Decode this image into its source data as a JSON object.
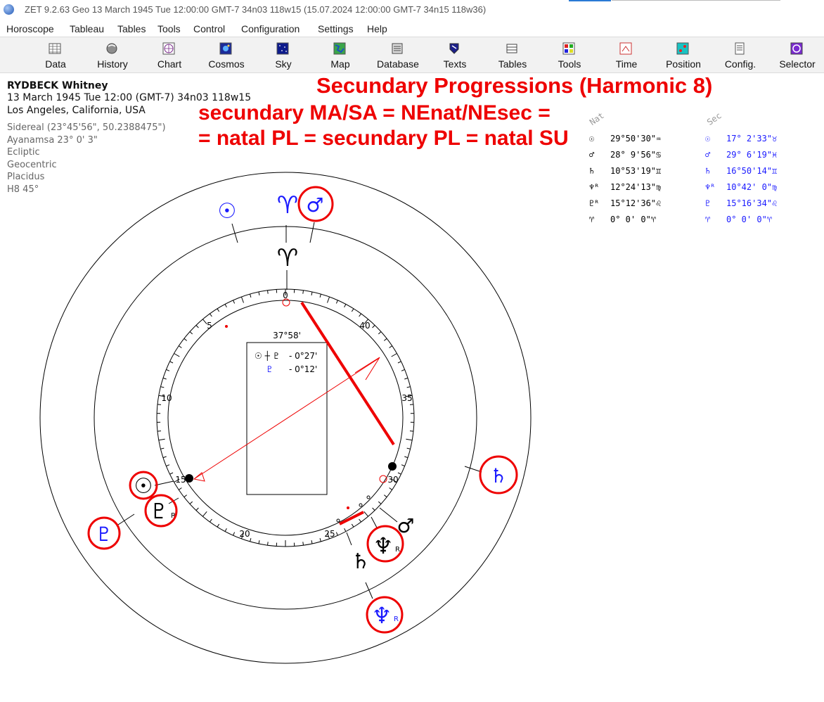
{
  "window": {
    "title": "ZET 9.2.63 Geo   13 March 1945  Tue  12:00:00 GMT-7 34n03  118w15  (15.07.2024  12:00:00 GMT-7 34n15  118w36)"
  },
  "menu": [
    "Horoscope",
    "Tableau",
    "Tables",
    "Tools",
    "Control",
    "Configuration",
    "Settings",
    "Help"
  ],
  "toolbar": [
    {
      "label": "Data",
      "icon": "data-grid-icon"
    },
    {
      "label": "History",
      "icon": "history-icon"
    },
    {
      "label": "Chart",
      "icon": "chart-wheel-icon"
    },
    {
      "label": "Cosmos",
      "icon": "cosmos-icon"
    },
    {
      "label": "Sky",
      "icon": "sky-icon"
    },
    {
      "label": "Map",
      "icon": "map-icon"
    },
    {
      "label": "Database",
      "icon": "database-icon"
    },
    {
      "label": "Texts",
      "icon": "texts-icon"
    },
    {
      "label": "Tables",
      "icon": "tables-icon"
    },
    {
      "label": "Tools",
      "icon": "tools-icon"
    },
    {
      "label": "Time",
      "icon": "time-icon"
    },
    {
      "label": "Position",
      "icon": "position-icon"
    },
    {
      "label": "Config.",
      "icon": "config-icon"
    },
    {
      "label": "Selector",
      "icon": "selector-icon"
    }
  ],
  "person": {
    "name": "RYDBECK Whitney",
    "datetime": "13 March 1945  Tue  12:00 (GMT-7) 34n03  118w15",
    "place": "Los Angeles, California, USA",
    "settings": [
      "Sidereal (23°45'56\", 50.2388475\")",
      "Ayanamsa 23° 0' 3\"",
      "Ecliptic",
      "Geocentric",
      "Placidus",
      "H8  45°"
    ]
  },
  "annotations": {
    "line1": "Secundary Progressions (Harmonic 8)",
    "line2": "secundary MA/SA = NEnat/NEsec =",
    "line3": "= natal PL = secundary PL = natal SU"
  },
  "positions": {
    "nat_header": "Nat",
    "sec_header": "Sec",
    "nat": [
      {
        "glyph": "☉",
        "value": "29°50'30\"",
        "sign": "♒"
      },
      {
        "glyph": "♂",
        "value": "28° 9'56\"",
        "sign": "♋"
      },
      {
        "glyph": "♄",
        "value": "10°53'19\"",
        "sign": "♊"
      },
      {
        "glyph": "♆ᴿ",
        "value": "12°24'13\"",
        "sign": "♍"
      },
      {
        "glyph": "♇ᴿ",
        "value": "15°12'36\"",
        "sign": "♌"
      },
      {
        "glyph": "♈",
        "value": " 0° 0' 0\"",
        "sign": "♈"
      }
    ],
    "sec": [
      {
        "glyph": "☉",
        "value": "17° 2'33\"",
        "sign": "♉"
      },
      {
        "glyph": "♂",
        "value": "29° 6'19\"",
        "sign": "♓"
      },
      {
        "glyph": "♄",
        "value": "16°50'14\"",
        "sign": "♊"
      },
      {
        "glyph": "♆ᴿ",
        "value": "10°42' 0\"",
        "sign": "♍"
      },
      {
        "glyph": "♇",
        "value": "15°16'34\"",
        "sign": "♌"
      },
      {
        "glyph": "♈",
        "value": " 0° 0' 0\"",
        "sign": "♈"
      }
    ]
  },
  "dial": {
    "axis_label": "37°58'",
    "ticks": [
      "0",
      "5",
      "10",
      "15",
      "20",
      "25",
      "30",
      "35",
      "40"
    ],
    "midpoints": [
      {
        "symbols": "☉ ┼ ♇",
        "orb": "- 0°27'"
      },
      {
        "symbols": "♇",
        "orb": "- 0°12'"
      }
    ]
  },
  "chart_glyphs": {
    "sec_sun": "☉",
    "sec_aries": "♈",
    "sec_mars": "♂",
    "nat_aries": "♈",
    "nat_sun": "☉",
    "nat_pluto": "♇",
    "sec_pluto": "♇",
    "sec_saturn": "♄",
    "nat_mars": "♂",
    "nat_neptune": "♆",
    "nat_saturn": "♄",
    "sec_neptune": "♆",
    "retro": "R"
  },
  "colors": {
    "natal": "#000000",
    "secondary": "#1a1aff",
    "annotation": "#ee0000",
    "menu_text": "#222222"
  }
}
